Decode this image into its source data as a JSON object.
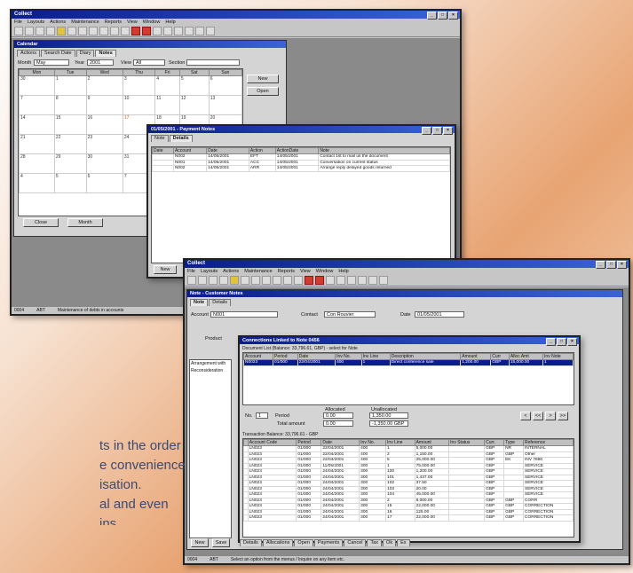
{
  "app_title": "Collect",
  "menu": [
    "File",
    "Layouts",
    "Actions",
    "Maintenance",
    "Reports",
    "View",
    "Window",
    "Help"
  ],
  "toolbar_icons": [
    "new-icon",
    "open-icon",
    "save-icon",
    "print-icon",
    "cut-icon",
    "copy-icon",
    "paste-icon",
    "undo-icon",
    "find-icon",
    "prev-icon",
    "next-icon",
    "stop-red-icon",
    "alert-yellow-icon",
    "go-green-icon",
    "user-icon",
    "group-icon",
    "note-icon",
    "window-icon",
    "calc-icon",
    "refresh-icon"
  ],
  "window1": {
    "child_title": "Calendar",
    "tabs": [
      "Actions",
      "Search Date",
      "Diary",
      "Notes"
    ],
    "controls": {
      "month_label": "Month",
      "month_value": "May",
      "year_label": "Year",
      "year_value": "2001",
      "view_label": "View",
      "view_value": "All",
      "section_label": "Section",
      "section_value": ""
    },
    "weekdays": [
      "Mon",
      "Tue",
      "Wed",
      "Thu",
      "Fri",
      "Sat",
      "Sun"
    ],
    "weeks": [
      [
        "30",
        "1",
        "2",
        "3",
        "4",
        "5",
        "6"
      ],
      [
        "7",
        "8",
        "9",
        "10",
        "11",
        "12",
        "13"
      ],
      [
        "14",
        "15",
        "16",
        "17",
        "18",
        "19",
        "20"
      ],
      [
        "21",
        "22",
        "23",
        "24",
        "25",
        "26",
        "27"
      ],
      [
        "28",
        "29",
        "30",
        "31",
        "1",
        "2",
        "3"
      ],
      [
        "4",
        "5",
        "6",
        "7",
        "8",
        "9",
        "10"
      ]
    ],
    "side_buttons": [
      "New",
      "Open"
    ],
    "bottom_buttons": [
      "Close",
      "Month"
    ],
    "status": [
      "0004",
      "ABT",
      "Maintenance of debts in accounts"
    ]
  },
  "window2": {
    "title": "01/05/2001 - Payment Notes",
    "tabs": [
      "Note",
      "Details"
    ],
    "columns": [
      "Date",
      "Account",
      "Date",
      "Action",
      "ActionDate",
      "Note"
    ],
    "rows": [
      [
        "",
        "N002",
        "14/05/2001",
        "EFT",
        "14/05/2001",
        "Contact 1st to mail us the document"
      ],
      [
        "",
        "N001",
        "14/05/2001",
        "ACC",
        "14/05/2001",
        "Conversation on current status"
      ],
      [
        "",
        "N002",
        "14/05/2001",
        "ARR",
        "14/05/2001",
        "Arrange reply delayed goods returned"
      ]
    ],
    "buttons": [
      "New"
    ]
  },
  "window3": {
    "child_title": "Note - Customer Notes",
    "tabs": [
      "Note",
      "Details"
    ],
    "fields": {
      "account_label": "Account",
      "account_value": "N001",
      "contact_label": "Contact",
      "contact_value": "Con Rouvier",
      "date_label": "Date",
      "date_value": "01/05/2001",
      "product_label": "Product"
    },
    "side_list": [
      "Arrangement with",
      "Reconsideration"
    ],
    "buttons": [
      "New",
      "Save"
    ]
  },
  "window4": {
    "title": "Connections Linked to Note 0456",
    "subtitle": "Document List (Balance: 33,796.61, GBP) - select for Note",
    "top_columns": [
      "Account",
      "Period",
      "Date",
      "Inv No.",
      "Inv Line",
      "Description",
      "Amount",
      "Curr",
      "Alloc Amt",
      "Inv Note"
    ],
    "top_rows": [
      [
        "N0023",
        "01/000",
        "22/04/2001",
        "400",
        "1",
        "Direct conference sale",
        "1,200.00",
        "GBP",
        "15,000.00",
        "1"
      ]
    ],
    "alloc": {
      "no_label": "No.",
      "no_value": "1",
      "period_label": "Period",
      "period_value": "0.00",
      "allocated_label": "Allocated",
      "allocated_value": "0.00",
      "unallocated_label": "Unallocated",
      "unallocated_value": "1,350.00",
      "amount_label": "Total amount",
      "amount_value": "0.00",
      "total_value": "-1,350.00 GBP"
    },
    "nav_buttons": [
      "<",
      "<<",
      ">",
      ">>"
    ],
    "bottom_title": "Transaction Balance: 33,796.61 - GBP",
    "bottom_columns": [
      "",
      "Account Code",
      "Period",
      "Date",
      "Inv No.",
      "Inv Line",
      "Amount",
      "Inv Status",
      "Curr.",
      "Type",
      "Reference"
    ],
    "bottom_rows": [
      [
        "",
        "LN023",
        "01/000",
        "22/04/2001",
        "400",
        "1",
        "5,000.00",
        "",
        "GBP",
        "NR",
        "INTERNAL"
      ],
      [
        "",
        "LN023",
        "01/000",
        "22/04/2001",
        "400",
        "2",
        "1,150.00",
        "",
        "GBP",
        "GBP",
        "Other"
      ],
      [
        "",
        "LN023",
        "01/000",
        "22/04/2001",
        "400",
        "5",
        "25,000.00",
        "",
        "GBP",
        "EK",
        "INV 7890"
      ],
      [
        "",
        "LN023",
        "01/000",
        "11/05/2001",
        "300",
        "1",
        "75,000.00",
        "",
        "GBP",
        "",
        "SERVICE"
      ],
      [
        "",
        "LN023",
        "01/000",
        "24/04/2001",
        "300",
        "100",
        "1,200.00",
        "",
        "GBP",
        "",
        "SERVICE"
      ],
      [
        "",
        "LN023",
        "01/000",
        "24/04/2001",
        "300",
        "101",
        "1,437.00",
        "",
        "GBP",
        "",
        "SERVICE"
      ],
      [
        "",
        "LN023",
        "01/000",
        "24/04/2001",
        "300",
        "102",
        "37.50",
        "",
        "GBP",
        "",
        "SERVICE"
      ],
      [
        "",
        "LN023",
        "01/000",
        "24/04/2001",
        "300",
        "103",
        "20.00",
        "",
        "GBP",
        "",
        "SERVICE"
      ],
      [
        "",
        "LN023",
        "01/000",
        "24/04/2001",
        "300",
        "104",
        "45,000.00",
        "",
        "GBP",
        "",
        "SERVICE"
      ],
      [
        "",
        "LN023",
        "01/000",
        "24/04/2001",
        "300",
        "2",
        "8,000.00",
        "",
        "GBP",
        "GBP",
        "CORR"
      ],
      [
        "",
        "LN023",
        "01/000",
        "24/04/2001",
        "300",
        "15",
        "22,000.00",
        "",
        "GBP",
        "GBP",
        "CORRECTION"
      ],
      [
        "",
        "LN023",
        "01/000",
        "24/04/2001",
        "300",
        "16",
        "125.00",
        "",
        "GBP",
        "GBP",
        "CORRECTION"
      ],
      [
        "",
        "LN023",
        "01/000",
        "24/04/2001",
        "300",
        "17",
        "22,000.00",
        "",
        "GBP",
        "GBP",
        "CORRECTION"
      ]
    ],
    "tab_strip": [
      "Details",
      "Allocations",
      "Open",
      "Payments",
      "Cancel",
      "Tax",
      "Ok",
      "Ex"
    ],
    "status": [
      "0004",
      "ABT",
      "Select an option from the menus / Inquire on any item etc."
    ]
  },
  "caption_lines": [
    "ts in the order",
    "e convenience",
    "isation.",
    "al and even",
    "ins"
  ]
}
